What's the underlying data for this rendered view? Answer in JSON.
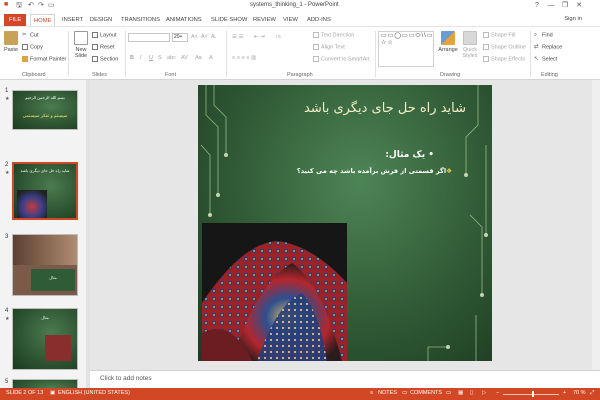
{
  "window": {
    "title": "systems_thinking_1 - PowerPoint",
    "help_label": "?",
    "minimize_label": "—",
    "restore_label": "❐",
    "close_label": "✕"
  },
  "quick_access": {
    "save_icon": "save-icon",
    "undo_icon": "undo-icon",
    "redo_icon": "redo-icon",
    "present_icon": "present-icon"
  },
  "tabs": [
    {
      "label": "FILE"
    },
    {
      "label": "HOME"
    },
    {
      "label": "INSERT"
    },
    {
      "label": "DESIGN"
    },
    {
      "label": "TRANSITIONS"
    },
    {
      "label": "ANIMATIONS"
    },
    {
      "label": "SLIDE SHOW"
    },
    {
      "label": "REVIEW"
    },
    {
      "label": "VIEW"
    },
    {
      "label": "ADD-INS"
    }
  ],
  "signin_label": "Sign in",
  "ribbon": {
    "clipboard": {
      "group": "Clipboard",
      "paste": "Paste",
      "cut": "Cut",
      "copy": "Copy",
      "format_painter": "Format Painter"
    },
    "slides": {
      "group": "Slides",
      "new_slide_line1": "New",
      "new_slide_line2": "Slide",
      "layout": "Layout",
      "reset": "Reset",
      "section": "Section"
    },
    "font": {
      "group": "Font",
      "size_value": "20+"
    },
    "paragraph": {
      "group": "Paragraph",
      "text_direction": "Text Direction",
      "align_text": "Align Text",
      "convert_smartart": "Convert to SmartArt"
    },
    "drawing": {
      "group": "Drawing",
      "arrange": "Arrange",
      "quick_styles_line1": "Quick",
      "quick_styles_line2": "Styles",
      "shape_fill": "Shape Fill",
      "shape_outline": "Shape Outline",
      "shape_effects": "Shape Effects",
      "shapes_glyphs": "▭▭◯▭▭⬭\\\\▭◁△▷↘⇒⌐⤷⤴⤹⤼↯☆{}☆☆"
    },
    "editing": {
      "group": "Editing",
      "find": "Find",
      "replace": "Replace",
      "select": "Select"
    }
  },
  "thumbnails": [
    {
      "num": "1",
      "title": "سیستم و تفکر سیستمی",
      "subtitle": "بسم الله الرحمن الرحیم"
    },
    {
      "num": "2",
      "title": "شاید راه حل جای دیگری باشد"
    },
    {
      "num": "3",
      "title": "مثال"
    },
    {
      "num": "4",
      "title": "مثال"
    },
    {
      "num": "5",
      "title": ""
    }
  ],
  "slide": {
    "title": "شاید راه حل جای دیگری باشد",
    "bullet": "یک مثال:",
    "bullet_mark": "•",
    "sub_mark": "❖",
    "subbullet": "اگر قسمتی از فرش برآمده باشد چه می کنید؟"
  },
  "notes_placeholder": "Click to add notes",
  "status": {
    "slide_info": "SLIDE 2 OF 13",
    "language": "ENGLISH (UNITED STATES)",
    "notes": "NOTES",
    "comments": "COMMENTS",
    "zoom": "70 %",
    "zoom_minus": "−",
    "zoom_plus": "+"
  },
  "colors": {
    "accent": "#d24726",
    "slide_bg": "#305a35",
    "title_text": "#f4f0c9"
  }
}
